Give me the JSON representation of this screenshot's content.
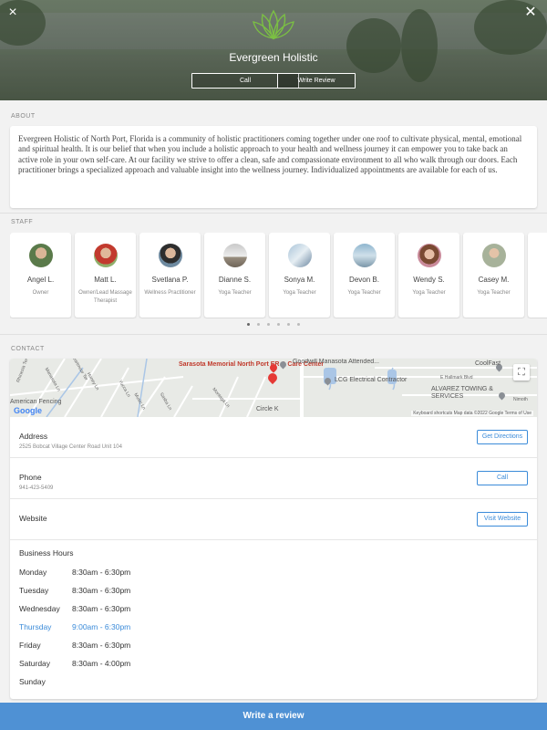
{
  "header": {
    "business_name": "Evergreen Holistic",
    "call_label": "Call",
    "write_review_label": "Write Review",
    "close_left": "×",
    "close_right": "✕"
  },
  "about": {
    "label": "ABOUT",
    "text": "Evergreen Holistic of North Port, Florida is a community of holistic practitioners coming together under one roof to cultivate physical, mental, emotional and spiritual health. It is our belief that when you include a holistic approach to your health and wellness journey it can empower you to take back an active role in your own self-care. At our facility we strive to offer a clean, safe and compassionate environment to all who walk through our doors. Each practitioner brings a specialized approach and valuable insight into the wellness journey. Individualized appointments are available for each of us."
  },
  "staff": {
    "label": "STAFF",
    "members": [
      {
        "name": "Angel L.",
        "role": "Owner"
      },
      {
        "name": "Matt L.",
        "role": "Owner/Lead Massage Therapist"
      },
      {
        "name": "Svetlana P.",
        "role": "Wellness Practitioner"
      },
      {
        "name": "Dianne S.",
        "role": "Yoga Teacher"
      },
      {
        "name": "Sonya M.",
        "role": "Yoga Teacher"
      },
      {
        "name": "Devon B.",
        "role": "Yoga Teacher"
      },
      {
        "name": "Wendy S.",
        "role": "Yoga Teacher"
      },
      {
        "name": "Casey M.",
        "role": "Yoga Teacher"
      }
    ],
    "pagination_count": 6,
    "active_page": 1
  },
  "contact": {
    "label": "CONTACT",
    "map": {
      "labels": {
        "hospital": "Sarasota Memorial North Port ER & Care Center",
        "goodwill": "Goodwill Manasota Attended...",
        "lcg": "LCG Electrical Contractor",
        "coolfast": "CoolFast",
        "hallmark": "E Hallmark Blvd",
        "alvarez": "ALVAREZ TOWING & SERVICES",
        "fencing": "American Fencing",
        "circlek": "Circle K",
        "dartmoor": "Dartmoor Ter",
        "honey": "Honey Ln",
        "yucca": "Yucca Ln",
        "music": "Music Ln",
        "sasba": "Sasba Ln",
        "montaga": "Montaga Ln",
        "rhine": "Rhinesia Ter",
        "manasota": "Manasota Ln",
        "nimoth": "Nimoth"
      },
      "google": "Google",
      "footer": "Keyboard shortcuts  Map data ©2022 Google  Terms of Use"
    },
    "address": {
      "title": "Address",
      "value": "2525 Bobcat Village Center Road Unit 104",
      "button": "Get Directions"
    },
    "phone": {
      "title": "Phone",
      "value": "941-423-5409",
      "button": "Call"
    },
    "website": {
      "title": "Website",
      "button": "Visit Website"
    },
    "hours": {
      "title": "Business Hours",
      "days": [
        {
          "day": "Monday",
          "time": "8:30am - 6:30pm"
        },
        {
          "day": "Tuesday",
          "time": "8:30am - 6:30pm"
        },
        {
          "day": "Wednesday",
          "time": "8:30am - 6:30pm"
        },
        {
          "day": "Thursday",
          "time": "9:00am - 6:30pm"
        },
        {
          "day": "Friday",
          "time": "8:30am - 6:30pm"
        },
        {
          "day": "Saturday",
          "time": "8:30am - 4:00pm"
        },
        {
          "day": "Sunday",
          "time": ""
        }
      ],
      "today_index": 3
    }
  },
  "bottom": {
    "write_review": "Write a review"
  },
  "colors": {
    "accent": "#4f91d4",
    "link": "#3b8bd9",
    "pin": "#e53935"
  }
}
